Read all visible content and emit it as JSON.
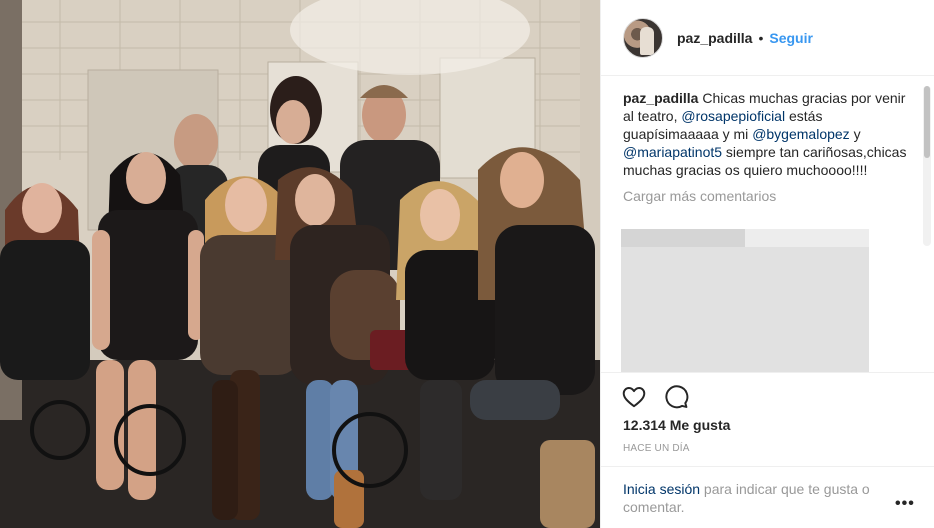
{
  "post": {
    "photo_alt": "",
    "header": {
      "username": "paz_padilla",
      "separator": "•",
      "follow_label": "Seguir"
    },
    "caption": {
      "username": "paz_padilla",
      "text_1": "Chicas muchas gracias por venir al teatro, ",
      "mention_1": "@rosapepioficial",
      "text_2": " estás guapísimaaaaa y mi ",
      "mention_2": "@bygemalopez",
      "text_3": " y ",
      "mention_3": "@mariapatinot5",
      "text_4": " siempre tan cariñosas,chicas muchas gracias os quiero muchoooo!!!!"
    },
    "load_more_label": "Cargar más comentarios",
    "likes_label": "12.314 Me gusta",
    "timestamp": "HACE UN DÍA",
    "login_prompt": {
      "link": "Inicia sesión",
      "rest": " para indicar que te gusta o comentar."
    },
    "more_label": "•••",
    "colors": {
      "link_blue": "#3897f0",
      "mention_blue": "#003569",
      "muted": "#999999"
    },
    "icons": [
      "heart-icon",
      "comment-icon",
      "more-options-icon"
    ]
  }
}
